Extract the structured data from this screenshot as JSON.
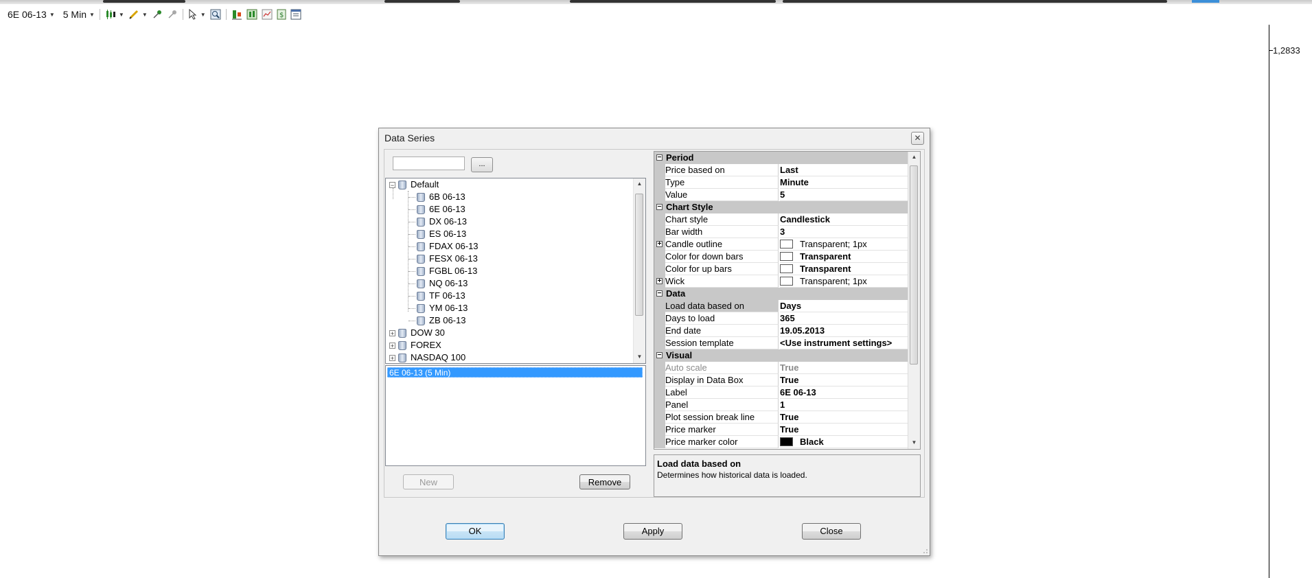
{
  "toolbar": {
    "instrument": "6E 06-13",
    "interval": "5 Min",
    "icons": [
      "candlestick-icon",
      "pencil-icon",
      "pin-icon",
      "crosshair-icon",
      "cursor-icon",
      "zoom-icon",
      "data-series-icon",
      "strategy-icon",
      "chart-type-icon",
      "dollar-icon",
      "properties-icon"
    ]
  },
  "chart": {
    "price_label": "1,2833"
  },
  "dialog": {
    "title": "Data Series",
    "close_glyph": "✕",
    "browse_label": "...",
    "search_value": "",
    "tree": {
      "root": "Default",
      "children": [
        "6B 06-13",
        "6E 06-13",
        "DX 06-13",
        "ES 06-13",
        "FDAX 06-13",
        "FESX 06-13",
        "FGBL 06-13",
        "NQ 06-13",
        "TF 06-13",
        "YM 06-13",
        "ZB 06-13"
      ],
      "lists": [
        "DOW 30",
        "FOREX",
        "NASDAQ 100"
      ]
    },
    "series_list": [
      "6E 06-13 (5 Min)"
    ],
    "buttons": {
      "new": "New",
      "remove": "Remove",
      "ok": "OK",
      "apply": "Apply",
      "close": "Close"
    },
    "properties": {
      "period": {
        "label": "Period",
        "price_based_on": {
          "name": "Price based on",
          "value": "Last"
        },
        "type": {
          "name": "Type",
          "value": "Minute"
        },
        "value": {
          "name": "Value",
          "value": "5"
        }
      },
      "chart_style": {
        "label": "Chart Style",
        "chart_style": {
          "name": "Chart style",
          "value": "Candlestick"
        },
        "bar_width": {
          "name": "Bar width",
          "value": "3"
        },
        "candle_outline": {
          "name": "Candle outline",
          "value": "Transparent; 1px"
        },
        "color_down": {
          "name": "Color for down bars",
          "value": "Transparent"
        },
        "color_up": {
          "name": "Color for up bars",
          "value": "Transparent"
        },
        "wick": {
          "name": "Wick",
          "value": "Transparent; 1px"
        }
      },
      "data": {
        "label": "Data",
        "load_based_on": {
          "name": "Load data based on",
          "value": "Days"
        },
        "days_to_load": {
          "name": "Days to load",
          "value": "365"
        },
        "end_date": {
          "name": "End date",
          "value": "19.05.2013"
        },
        "session_template": {
          "name": "Session template",
          "value": "<Use instrument settings>"
        }
      },
      "visual": {
        "label": "Visual",
        "auto_scale": {
          "name": "Auto scale",
          "value": "True"
        },
        "display_data_box": {
          "name": "Display in Data Box",
          "value": "True"
        },
        "label_prop": {
          "name": "Label",
          "value": "6E 06-13"
        },
        "panel": {
          "name": "Panel",
          "value": "1"
        },
        "plot_session_break": {
          "name": "Plot session break line",
          "value": "True"
        },
        "price_marker": {
          "name": "Price marker",
          "value": "True"
        },
        "price_marker_color": {
          "name": "Price marker color",
          "value": "Black"
        }
      }
    },
    "help": {
      "title": "Load data based on",
      "description": "Determines how historical data is loaded."
    }
  }
}
